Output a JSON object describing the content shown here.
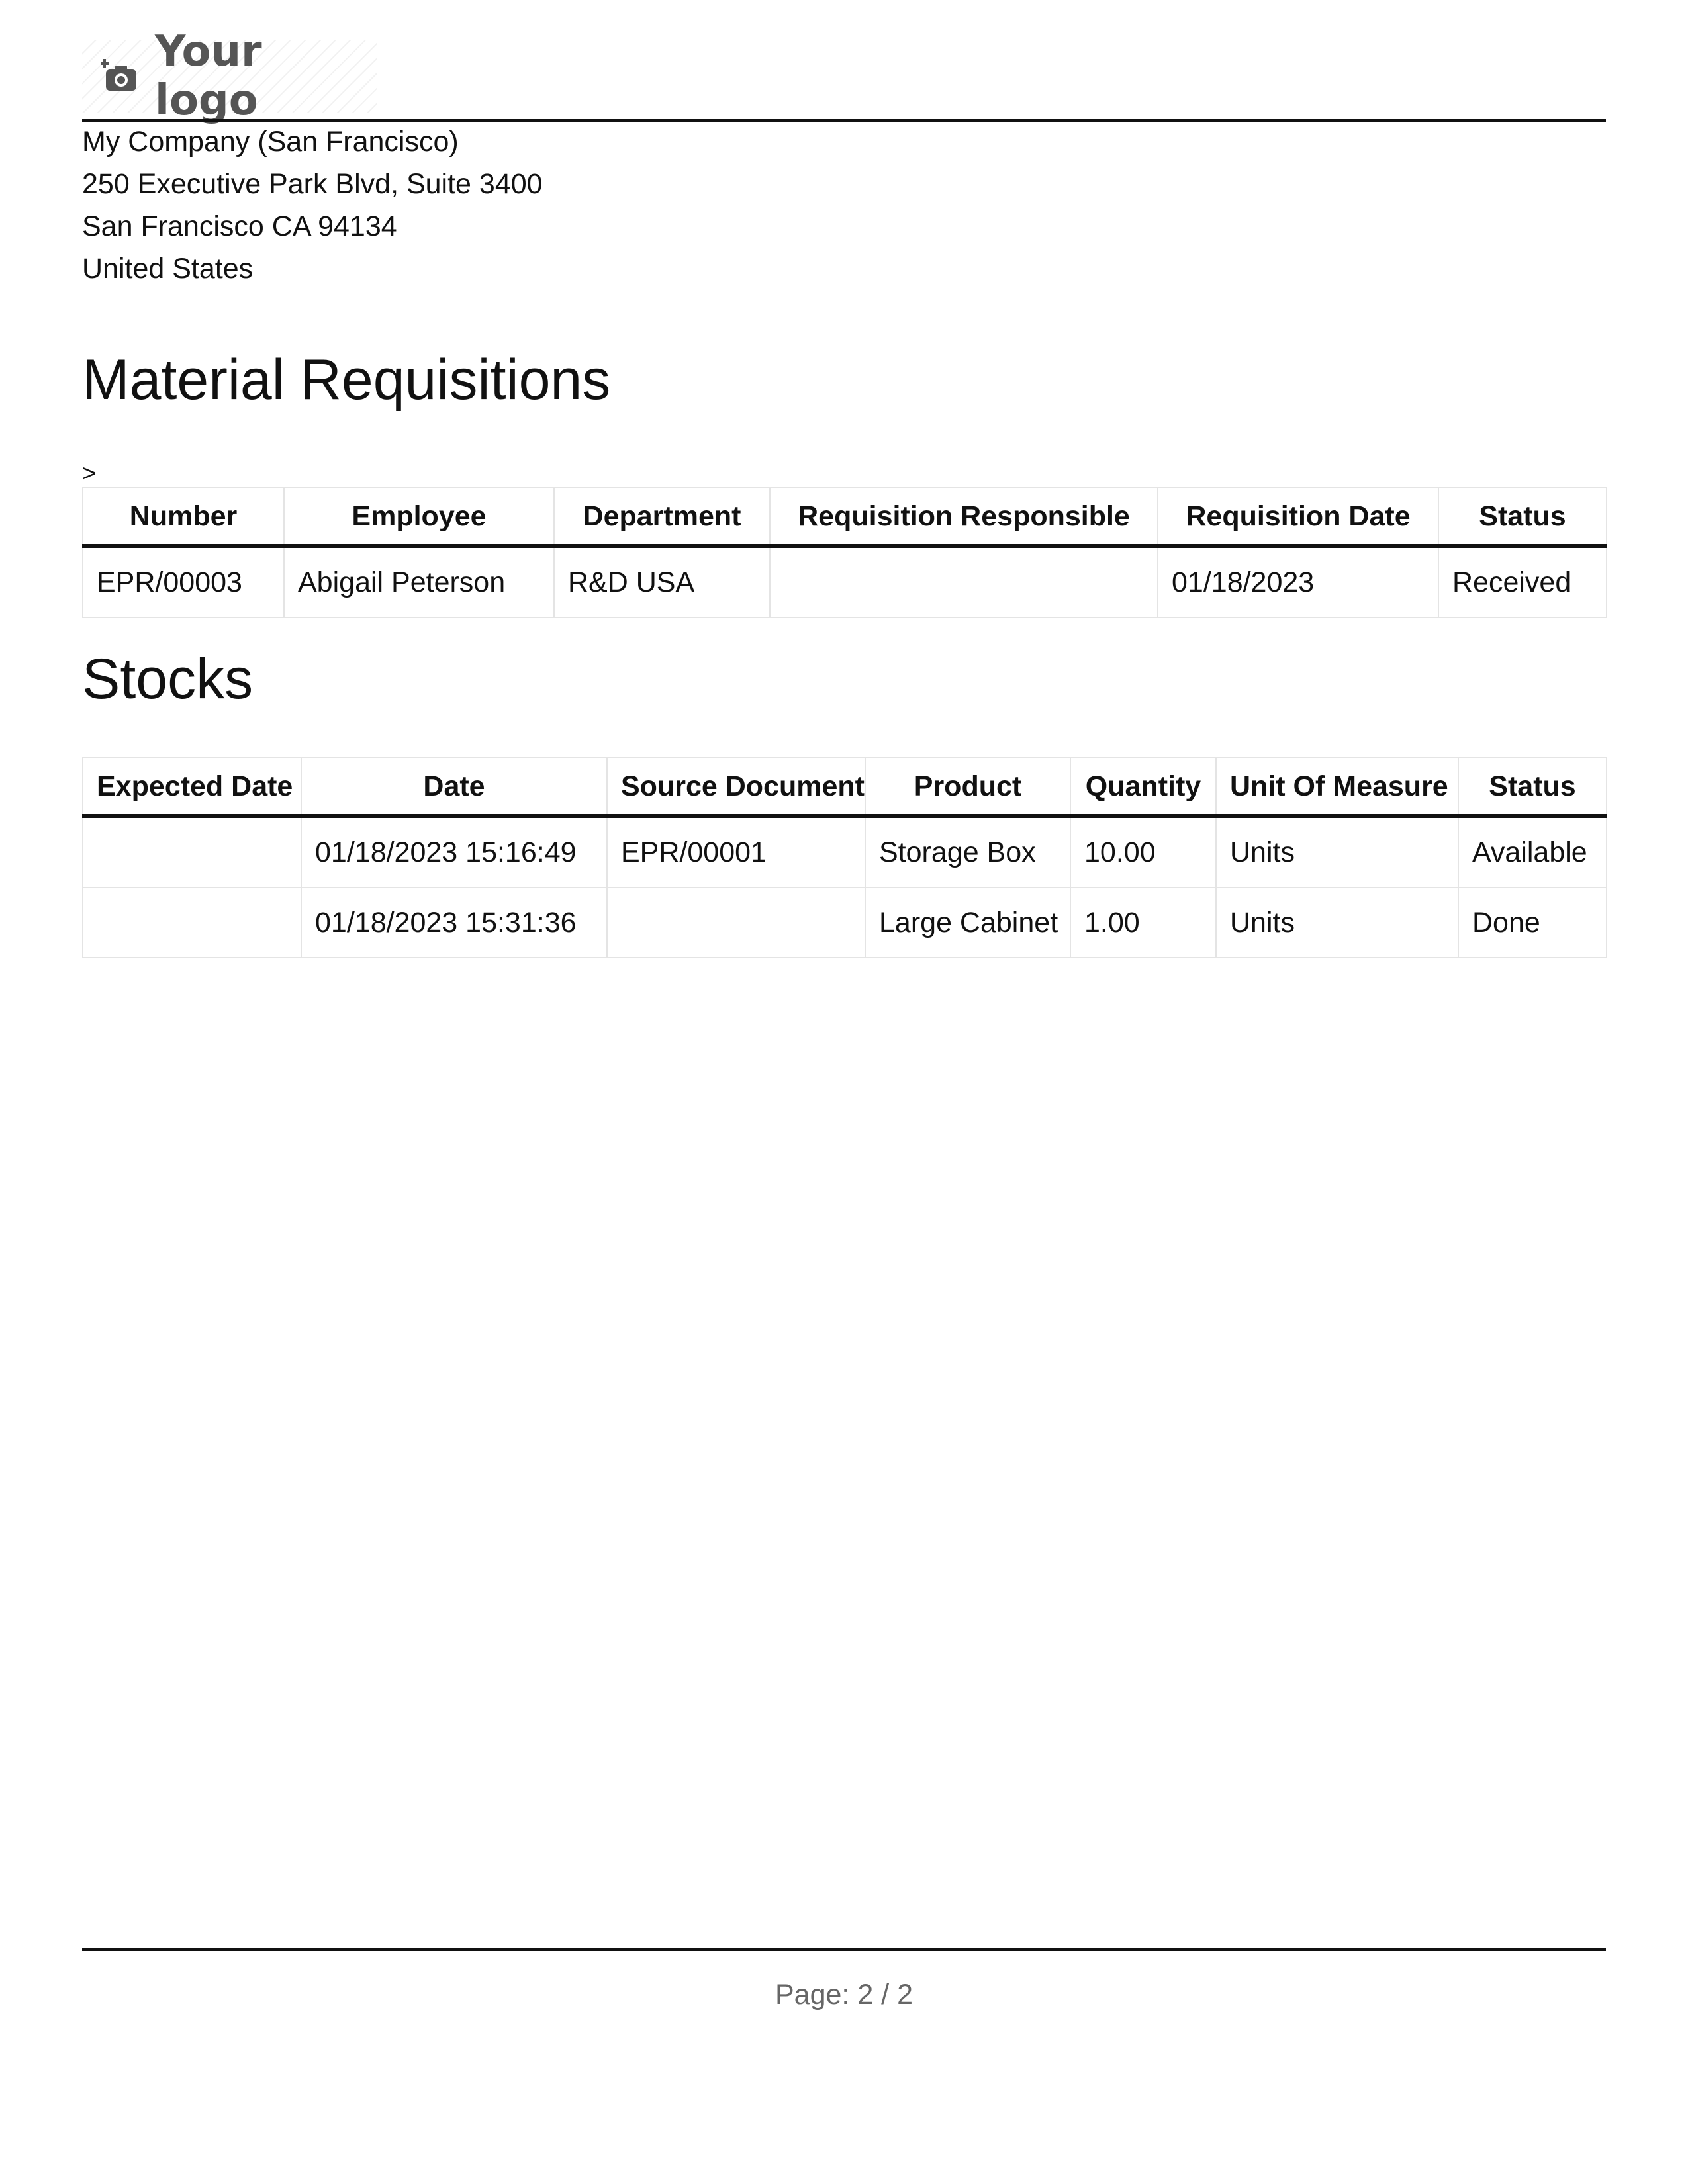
{
  "logo": {
    "text": "Your logo",
    "icon": "camera-plus-icon"
  },
  "company": {
    "name": "My Company (San Francisco)",
    "street": "250 Executive Park Blvd, Suite 3400",
    "city": "San Francisco CA 94134",
    "country": "United States"
  },
  "requisitions": {
    "title": "Material Requisitions",
    "marker": ">",
    "columns": [
      "Number",
      "Employee",
      "Department",
      "Requisition Responsible",
      "Requisition Date",
      "Status"
    ],
    "rows": [
      [
        "EPR/00003",
        "Abigail Peterson",
        "R&D USA",
        "",
        "01/18/2023",
        "Received"
      ]
    ]
  },
  "stocks": {
    "title": "Stocks",
    "columns": [
      "Expected Date",
      "Date",
      "Source Document",
      "Product",
      "Quantity",
      "Unit Of Measure",
      "Status"
    ],
    "rows": [
      [
        "",
        "01/18/2023 15:16:49",
        "EPR/00001",
        "Storage Box",
        "10.00",
        "Units",
        "Available"
      ],
      [
        "",
        "01/18/2023 15:31:36",
        "",
        "Large Cabinet",
        "1.00",
        "Units",
        "Done"
      ]
    ]
  },
  "footer": {
    "page_label": "Page: 2 / 2"
  }
}
